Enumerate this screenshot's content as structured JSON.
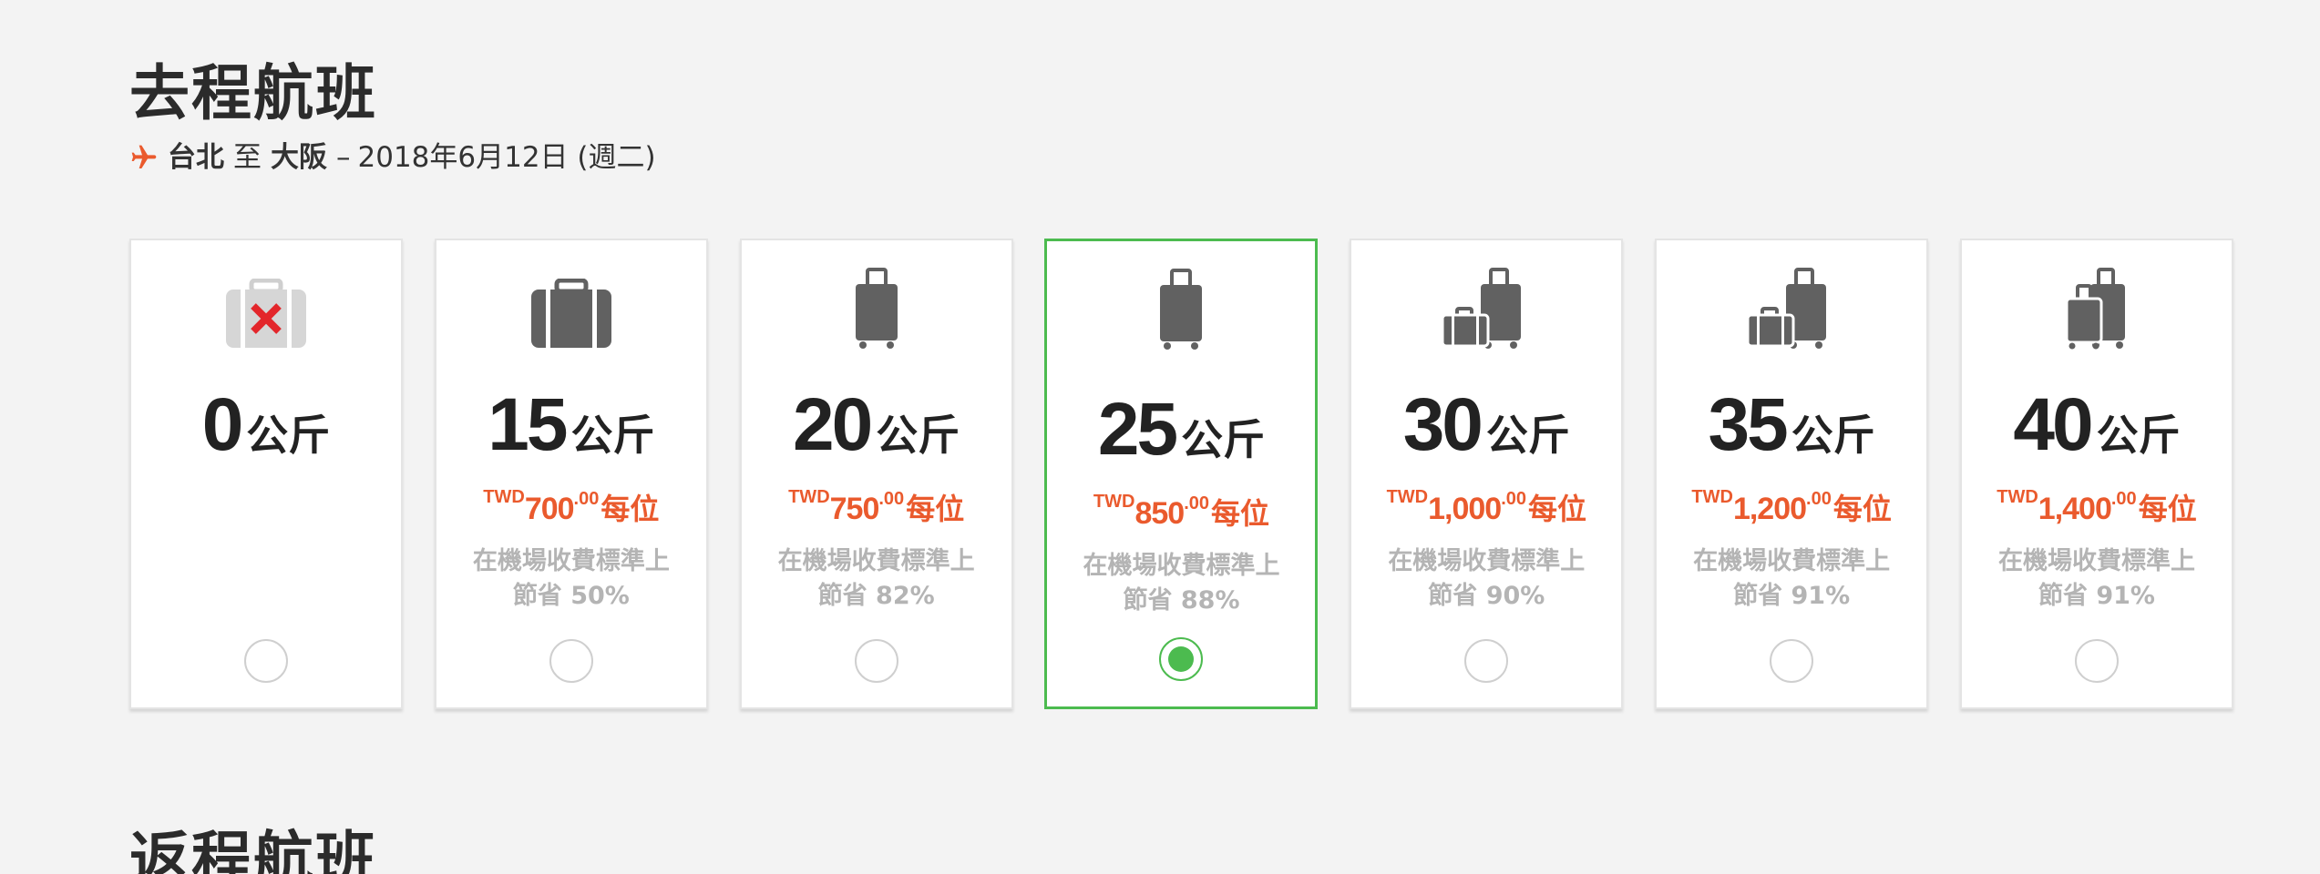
{
  "outbound": {
    "title": "去程航班",
    "route": {
      "origin": "台北",
      "to_word": "至",
      "destination": "大阪",
      "dash": "–",
      "date": "2018年6月12日 (週二)"
    }
  },
  "return": {
    "title": "返程航班"
  },
  "colors": {
    "accent_orange": "#ea5a2d",
    "selected_green": "#4cbb4f",
    "muted_text": "#b4b4b4",
    "icon_gray": "#616161"
  },
  "baggage_options": [
    {
      "weight": "0",
      "unit": "公斤",
      "icon": "no-baggage-icon",
      "selected": false
    },
    {
      "weight": "15",
      "unit": "公斤",
      "icon": "suitcase-icon",
      "currency": "TWD",
      "amount": "700",
      "decimals": ".00",
      "per": "每位",
      "savings_line1": "在機場收費標準上",
      "savings_line2": "節省 50%",
      "selected": false
    },
    {
      "weight": "20",
      "unit": "公斤",
      "icon": "trolley-bag-icon",
      "currency": "TWD",
      "amount": "750",
      "decimals": ".00",
      "per": "每位",
      "savings_line1": "在機場收費標準上",
      "savings_line2": "節省 82%",
      "selected": false
    },
    {
      "weight": "25",
      "unit": "公斤",
      "icon": "trolley-bag-icon",
      "currency": "TWD",
      "amount": "850",
      "decimals": ".00",
      "per": "每位",
      "savings_line1": "在機場收費標準上",
      "savings_line2": "節省 88%",
      "selected": true
    },
    {
      "weight": "30",
      "unit": "公斤",
      "icon": "two-bags-icon",
      "currency": "TWD",
      "amount": "1,000",
      "decimals": ".00",
      "per": "每位",
      "savings_line1": "在機場收費標準上",
      "savings_line2": "節省 90%",
      "selected": false
    },
    {
      "weight": "35",
      "unit": "公斤",
      "icon": "two-bags-icon",
      "currency": "TWD",
      "amount": "1,200",
      "decimals": ".00",
      "per": "每位",
      "savings_line1": "在機場收費標準上",
      "savings_line2": "節省 91%",
      "selected": false
    },
    {
      "weight": "40",
      "unit": "公斤",
      "icon": "two-trolley-bags-icon",
      "currency": "TWD",
      "amount": "1,400",
      "decimals": ".00",
      "per": "每位",
      "savings_line1": "在機場收費標準上",
      "savings_line2": "節省 91%",
      "selected": false
    }
  ]
}
